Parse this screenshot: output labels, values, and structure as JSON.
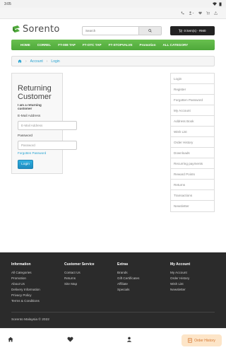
{
  "statusbar": {
    "time": "3:05"
  },
  "topbar": {
    "phone_icon": "phone-icon",
    "account_icon": "user-icon",
    "wishlist_icon": "heart-icon",
    "cart_icon": "cart-icon",
    "share_icon": "share-icon"
  },
  "brand": {
    "name": "Sorento",
    "accent": "#4ea83a"
  },
  "search": {
    "placeholder": "Search"
  },
  "cart": {
    "label": "0 item(s) - RM0"
  },
  "nav": {
    "items": [
      "HOME",
      "CORREL",
      "FT-008 TAP",
      "FT-OTC TAP",
      "FT-STOPVALVE",
      "Promotion",
      "ALL CATEGORY"
    ]
  },
  "breadcrumb": {
    "items": [
      "Account",
      "Login"
    ]
  },
  "login": {
    "title": "Returning Customer",
    "subtitle": "I am a returning customer",
    "email_label": "E-Mail Address",
    "email_placeholder": "E-Mail Address",
    "password_label": "Password",
    "password_placeholder": "Password",
    "forgot": "Forgotten Password",
    "button": "Login"
  },
  "sidebar": {
    "items": [
      "Login",
      "Register",
      "Forgotten Password",
      "My Account",
      "Address Book",
      "Wish List",
      "Order History",
      "Downloads",
      "Recurring payments",
      "Reward Points",
      "Returns",
      "Transactions",
      "Newsletter"
    ]
  },
  "footer": {
    "columns": [
      {
        "title": "Information",
        "links": [
          "All Categories",
          "Promotion",
          "About Us",
          "Delivery Information",
          "Privacy Policy",
          "Terms & Conditions"
        ]
      },
      {
        "title": "Customer Service",
        "links": [
          "Contact Us",
          "Returns",
          "Site Map"
        ]
      },
      {
        "title": "Extras",
        "links": [
          "Brands",
          "Gift Certificates",
          "Affiliate",
          "Specials"
        ]
      },
      {
        "title": "My Account",
        "links": [
          "My Account",
          "Order History",
          "Wish List",
          "Newsletter"
        ]
      }
    ],
    "copyright": "Sorento Malaysia © 2022"
  },
  "bottombar": {
    "order_history": "Order History"
  }
}
